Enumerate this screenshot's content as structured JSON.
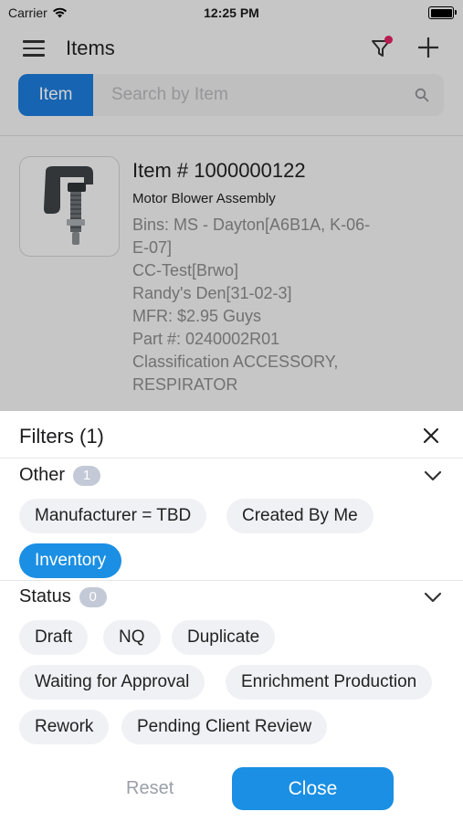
{
  "status_bar": {
    "carrier": "Carrier",
    "time": "12:25 PM"
  },
  "nav": {
    "title": "Items",
    "filter_active": true
  },
  "search": {
    "scope_label": "Item",
    "placeholder": "Search by Item"
  },
  "item": {
    "title": "Item # 1000000122",
    "subtitle": "Motor Blower Assembly",
    "details": [
      "Bins: MS - Dayton[A6B1A, K-06-",
      "E-07]",
      "CC-Test[Brwo]",
      "Randy's Den[31-02-3]",
      "MFR: $2.95 Guys",
      "Part #: 0240002R01",
      "Classification ACCESSORY,",
      "RESPIRATOR"
    ]
  },
  "filters": {
    "title": "Filters (1)",
    "other": {
      "label": "Other",
      "count": "1",
      "chips": [
        "Manufacturer = TBD",
        "Created By Me",
        "Inventory"
      ],
      "selected": "Inventory"
    },
    "status": {
      "label": "Status",
      "count": "0",
      "chips": [
        "Draft",
        "NQ",
        "Duplicate",
        "Waiting for Approval",
        "Enrichment Production",
        "Rework",
        "Pending Client Review"
      ]
    },
    "reset_label": "Reset",
    "close_label": "Close"
  },
  "colors": {
    "accent": "#1a8fe3",
    "badge": "#c3c9d6",
    "notification": "#e0245e"
  }
}
